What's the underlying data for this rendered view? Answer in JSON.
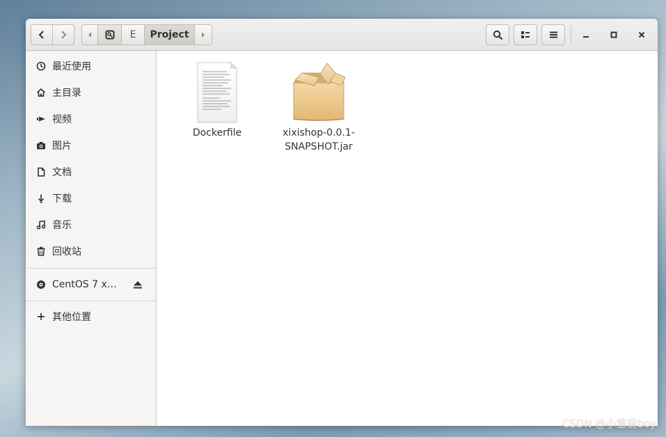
{
  "header": {
    "path": [
      "E",
      "Project"
    ]
  },
  "sidebar": {
    "items": [
      {
        "label": "最近使用",
        "icon": "recent-icon"
      },
      {
        "label": "主目录",
        "icon": "home-icon"
      },
      {
        "label": "视频",
        "icon": "video-icon"
      },
      {
        "label": "图片",
        "icon": "camera-icon"
      },
      {
        "label": "文档",
        "icon": "document-icon"
      },
      {
        "label": "下载",
        "icon": "download-icon"
      },
      {
        "label": "音乐",
        "icon": "music-icon"
      },
      {
        "label": "回收站",
        "icon": "trash-icon"
      }
    ],
    "device": {
      "label": "CentOS 7 x…",
      "icon": "disc-icon",
      "action_icon": "eject-icon"
    },
    "other": {
      "label": "其他位置",
      "icon": "plus-icon"
    }
  },
  "files": [
    {
      "name": "Dockerfile",
      "icon": "text-file-icon"
    },
    {
      "name_line1": "xixishop-0.0.1-",
      "name_line2": "SNAPSHOT.jar",
      "icon": "package-icon"
    }
  ],
  "watermark": "CSDN @小雏菊boy",
  "colors": {
    "header_bg": "#e8e7e5",
    "sidebar_bg": "#f6f5f4",
    "text": "#2e3436",
    "package_tan": "#e9c88e"
  }
}
